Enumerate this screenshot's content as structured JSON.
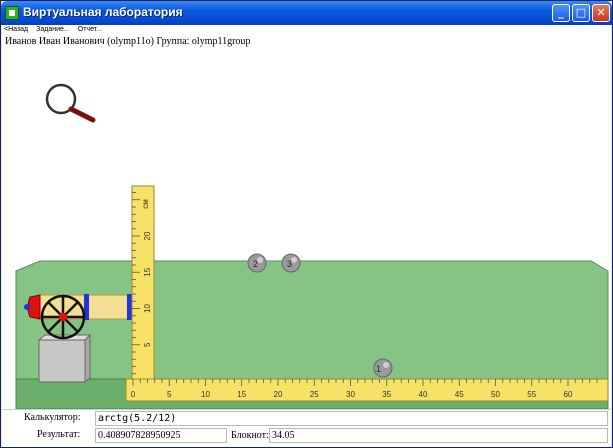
{
  "window": {
    "title": "Виртуальная лаборатория",
    "minimize_glyph": "_",
    "maximize_glyph": "□",
    "close_glyph": "✕"
  },
  "menu": {
    "items": [
      "<Назад",
      "Задание...",
      "Отчет..."
    ]
  },
  "user": {
    "line": "Иванов Иван Иванович (olymp11o)  Группа: olymp11group"
  },
  "lab": {
    "vertical_ruler": {
      "unit": "см",
      "labels": [
        "0",
        "5",
        "10",
        "15",
        "20"
      ]
    },
    "horizontal_ruler": {
      "labels": [
        "0",
        "5",
        "10",
        "15",
        "20",
        "25",
        "30",
        "35",
        "40",
        "45",
        "50",
        "55",
        "60"
      ]
    },
    "balls": [
      {
        "label": "2"
      },
      {
        "label": "3"
      },
      {
        "label": "1"
      }
    ],
    "colors": {
      "table": "#86c486",
      "ruler": "#f7e267",
      "barrel_band": "#2233dd",
      "cannon_cap": "#dd1111",
      "wheel": "#111111",
      "stand": "#c8c8c8"
    },
    "icons": [
      "magnifier-icon",
      "cannon-icon",
      "wheel-icon"
    ]
  },
  "bottom": {
    "calculator_label": "Калькулятор:",
    "calculator_value": "arctg(5.2/12)",
    "result_label": "Результат:",
    "result_value": "0.408907828950925",
    "notepad_label": "Блокнот:",
    "notepad_value": "34.05"
  }
}
